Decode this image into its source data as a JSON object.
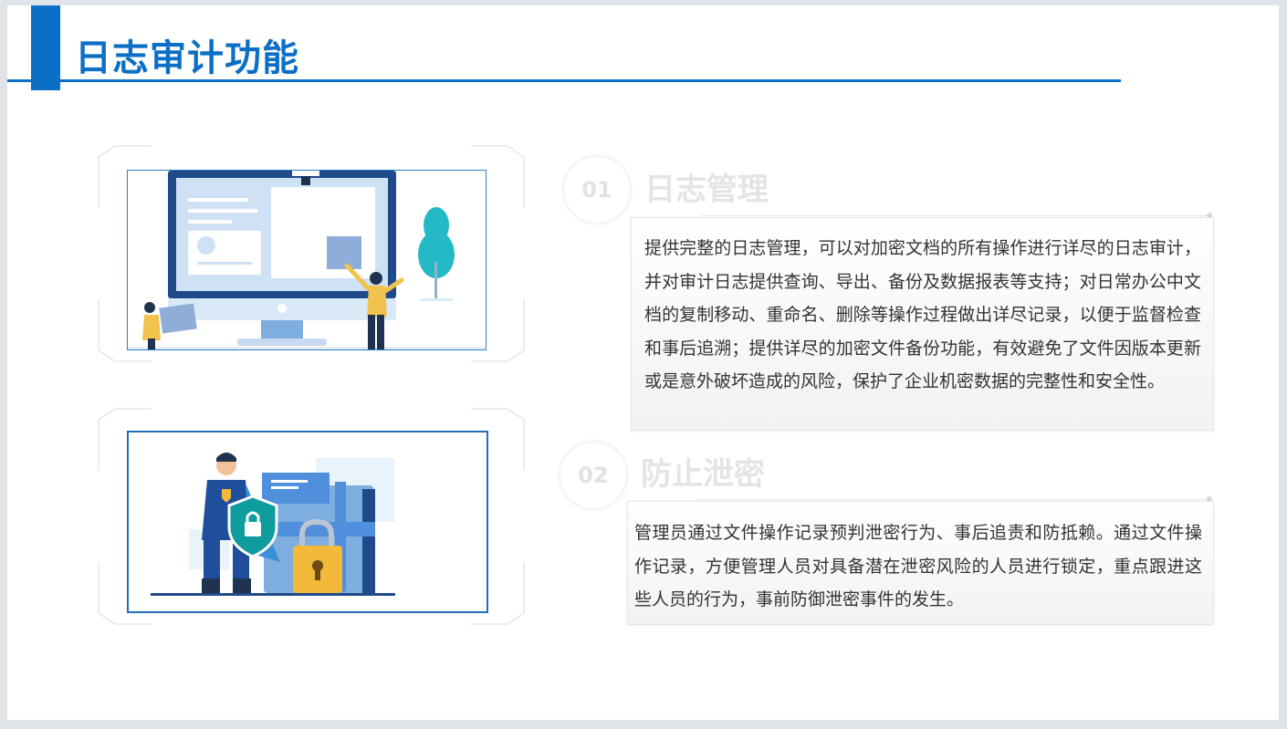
{
  "page": {
    "title": "日志审计功能"
  },
  "sections": [
    {
      "number": "01",
      "title": "日志管理",
      "body": "提供完整的日志管理，可以对加密文档的所有操作进行详尽的日志审计，并对审计日志提供查询、导出、备份及数据报表等支持；对日常办公中文档的复制移动、重命名、删除等操作过程做出详尽记录，以便于监督检查和事后追溯；提供详尽的加密文件备份功能，有效避免了文件因版本更新或是意外破坏造成的风险，保护了企业机密数据的完整性和安全性。",
      "illustration": "computer-monitor-illustration"
    },
    {
      "number": "02",
      "title": "防止泄密",
      "body": "管理员通过文件操作记录预判泄密行为、事后追责和防抵赖。通过文件操作记录，方便管理人员对具备潜在泄密风险的人员进行锁定，重点跟进这些人员的行为，事前防御泄密事件的发生。",
      "illustration": "security-guard-illustration"
    }
  ],
  "colors": {
    "accent": "#0b6fc6",
    "body_text": "#333333",
    "faded_heading": "#e4e4e4"
  }
}
